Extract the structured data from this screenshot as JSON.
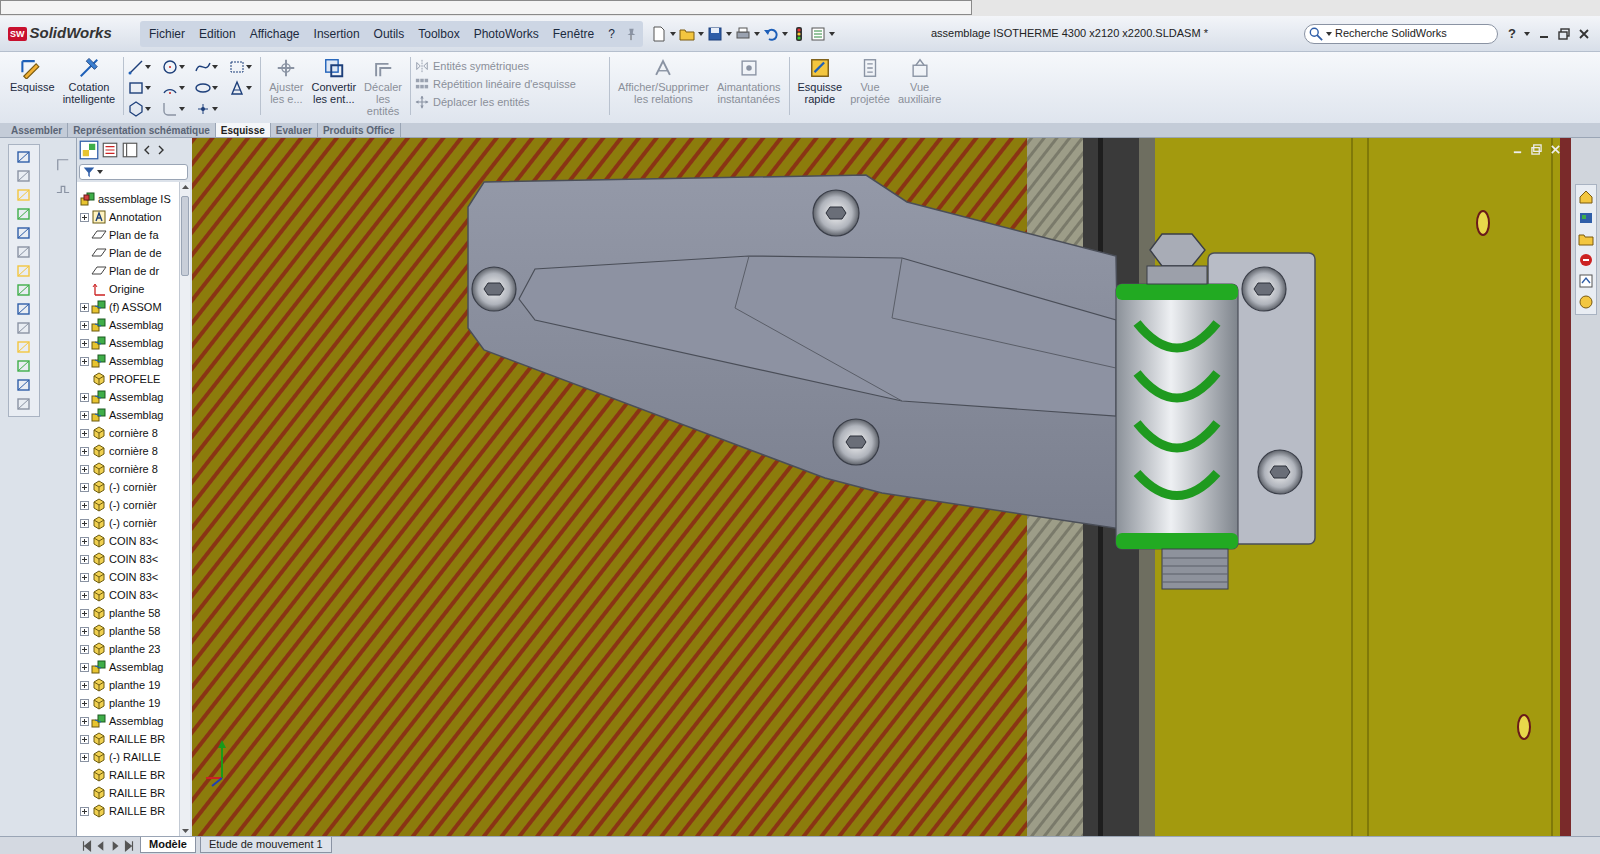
{
  "window": {
    "title": "assemblage ISOTHERME 4300 x2120 x2200.SLDASM *"
  },
  "logo": {
    "badge": "SW",
    "name": "SolidWorks"
  },
  "menu": [
    {
      "label": "Fichier"
    },
    {
      "label": "Edition"
    },
    {
      "label": "Affichage"
    },
    {
      "label": "Insertion"
    },
    {
      "label": "Outils"
    },
    {
      "label": "Toolbox"
    },
    {
      "label": "PhotoWorks"
    },
    {
      "label": "Fenêtre"
    },
    {
      "label": "?"
    }
  ],
  "search": {
    "placeholder": "Recherche SolidWorks"
  },
  "help_button": "?",
  "command_manager": {
    "groups": [
      {
        "kind": "large",
        "items": [
          {
            "lines": [
              "Esquisse"
            ],
            "disabled": false
          },
          {
            "lines": [
              "Cotation",
              "intelligente"
            ],
            "disabled": false
          }
        ]
      },
      {
        "kind": "tools",
        "items": []
      },
      {
        "kind": "large",
        "items": [
          {
            "lines": [
              "Ajuster",
              "les e..."
            ],
            "disabled": true
          },
          {
            "lines": [
              "Convertir",
              "les ent..."
            ],
            "disabled": false
          },
          {
            "lines": [
              "Décaler",
              "les",
              "entités"
            ],
            "disabled": true
          }
        ]
      },
      {
        "kind": "small",
        "items": [
          {
            "lines": [
              "Entités symétriques"
            ],
            "disabled": true
          },
          {
            "lines": [
              "Répétition linéaire d'esquisse"
            ],
            "disabled": true
          },
          {
            "lines": [
              "Déplacer les entités"
            ],
            "disabled": true
          }
        ]
      },
      {
        "kind": "large",
        "items": [
          {
            "lines": [
              "Afficher/Supprimer",
              "les relations"
            ],
            "disabled": true
          },
          {
            "lines": [
              "Aimantations",
              "instantanées"
            ],
            "disabled": true
          }
        ]
      },
      {
        "kind": "large",
        "items": [
          {
            "lines": [
              "Esquisse",
              "rapide"
            ],
            "disabled": false
          },
          {
            "lines": [
              "Vue",
              "projetée"
            ],
            "disabled": true
          },
          {
            "lines": [
              "Vue",
              "auxiliaire"
            ],
            "disabled": true
          }
        ]
      }
    ]
  },
  "tabs": [
    {
      "label": "Assembler",
      "selected": false
    },
    {
      "label": "Représentation schématique",
      "selected": false
    },
    {
      "label": "Esquisse",
      "selected": true
    },
    {
      "label": "Evaluer",
      "selected": false
    },
    {
      "label": "Produits Office",
      "selected": false
    }
  ],
  "tree": {
    "items": [
      {
        "label": "assemblage IS",
        "kind": "root",
        "expandable": false
      },
      {
        "label": "Annotation",
        "kind": "annotation",
        "expandable": true
      },
      {
        "label": "Plan de fa",
        "kind": "plane",
        "expandable": false
      },
      {
        "label": "Plan de de",
        "kind": "plane",
        "expandable": false
      },
      {
        "label": "Plan de dr",
        "kind": "plane",
        "expandable": false
      },
      {
        "label": "Origine",
        "kind": "origin",
        "expandable": false
      },
      {
        "label": "(f) ASSOM",
        "kind": "assembly",
        "expandable": true
      },
      {
        "label": "Assemblag",
        "kind": "assembly",
        "expandable": true
      },
      {
        "label": "Assemblag",
        "kind": "assembly",
        "expandable": true
      },
      {
        "label": "Assemblag",
        "kind": "assembly",
        "expandable": true
      },
      {
        "label": "PROFELE",
        "kind": "part",
        "expandable": false
      },
      {
        "label": "Assemblag",
        "kind": "assembly",
        "expandable": true
      },
      {
        "label": "Assemblag",
        "kind": "assembly",
        "expandable": true
      },
      {
        "label": "cornière 8",
        "kind": "part",
        "expandable": true
      },
      {
        "label": "cornière 8",
        "kind": "part",
        "expandable": true
      },
      {
        "label": "cornière 8",
        "kind": "part",
        "expandable": true
      },
      {
        "label": "(-) cornièr",
        "kind": "part",
        "expandable": true
      },
      {
        "label": "(-) cornièr",
        "kind": "part",
        "expandable": true
      },
      {
        "label": "(-) cornièr",
        "kind": "part",
        "expandable": true
      },
      {
        "label": "COIN 83<",
        "kind": "part",
        "expandable": true
      },
      {
        "label": "COIN 83<",
        "kind": "part",
        "expandable": true
      },
      {
        "label": "COIN 83<",
        "kind": "part",
        "expandable": true
      },
      {
        "label": "COIN 83<",
        "kind": "part",
        "expandable": true
      },
      {
        "label": "planthe 58",
        "kind": "part",
        "expandable": true
      },
      {
        "label": "planthe 58",
        "kind": "part",
        "expandable": true
      },
      {
        "label": "planthe 23",
        "kind": "part",
        "expandable": true
      },
      {
        "label": "Assemblag",
        "kind": "assembly",
        "expandable": true
      },
      {
        "label": "planthe 19",
        "kind": "part",
        "expandable": true
      },
      {
        "label": "planthe 19",
        "kind": "part",
        "expandable": true
      },
      {
        "label": "Assemblag",
        "kind": "assembly",
        "expandable": true
      },
      {
        "label": "RAILLE BR",
        "kind": "part",
        "expandable": true
      },
      {
        "label": "(-) RAILLE",
        "kind": "part",
        "expandable": true
      },
      {
        "label": "RAILLE BR",
        "kind": "part",
        "expandable": false
      },
      {
        "label": "RAILLE BR",
        "kind": "part",
        "expandable": false
      },
      {
        "label": "RAILLE BR",
        "kind": "part",
        "expandable": true
      }
    ]
  },
  "bottom_tabs": [
    {
      "label": "Modèle",
      "selected": true
    },
    {
      "label": "Etude de mouvement 1",
      "selected": false
    }
  ]
}
